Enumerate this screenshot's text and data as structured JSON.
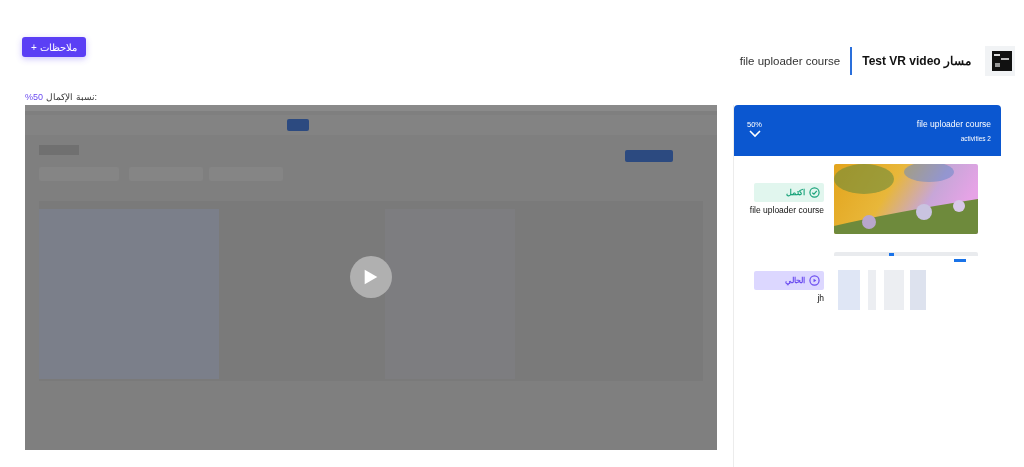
{
  "notes_button": {
    "label": "+ ملاحظات"
  },
  "header": {
    "path_label": "مسار Test VR video",
    "course": "file uploader course"
  },
  "completion": {
    "label": "نسبة الإكمال:",
    "value": "%50"
  },
  "course_panel": {
    "title": "file uploader course",
    "activities": "activities 2",
    "progress": "50%",
    "expanded": true,
    "activities_list": [
      {
        "kind": "completed",
        "status": "اكتمل",
        "title": "file uploader course"
      },
      {
        "kind": "current",
        "status": "الحالي",
        "title": "jh"
      }
    ]
  }
}
